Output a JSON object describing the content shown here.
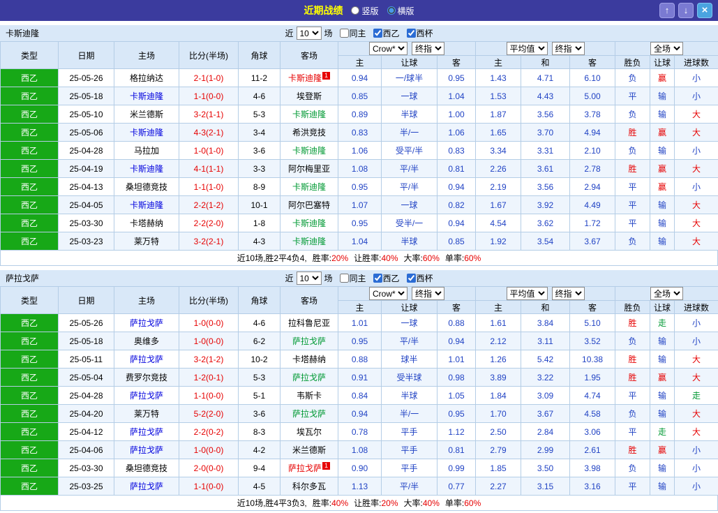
{
  "topbar": {
    "title": "近期战绩",
    "radios": [
      {
        "label": "竖版",
        "selected": false
      },
      {
        "label": "横版",
        "selected": true
      }
    ],
    "buttons": {
      "up": "↑",
      "down": "↓",
      "close": "×"
    }
  },
  "filter": {
    "near": "近",
    "count": "10",
    "games": "场",
    "options": [
      {
        "label": "同主",
        "checked": false
      },
      {
        "label": "西乙",
        "checked": true
      },
      {
        "label": "西杯",
        "checked": true
      }
    ]
  },
  "table_header": {
    "row1": [
      "类型",
      "日期",
      "主场",
      "比分(半场)",
      "角球",
      "客场"
    ],
    "dropdowns": {
      "asia": [
        "Crow*",
        "终指"
      ],
      "euro": [
        "平均值",
        "终指"
      ],
      "result": [
        "全场"
      ]
    },
    "row2": [
      "主",
      "让球",
      "客",
      "主",
      "和",
      "客",
      "胜负",
      "让球",
      "进球数"
    ]
  },
  "sections": [
    {
      "team": "卡斯迪隆",
      "rows": [
        {
          "league": "西乙",
          "date": "25-05-26",
          "home": "格拉纳达",
          "home_color": "black",
          "score": "2-1(1-0)",
          "corners": "11-2",
          "away": "卡斯迪隆",
          "away_color": "red",
          "away_badge": "1",
          "asia_home": "0.94",
          "handicap": "一/球半",
          "asia_away": "0.95",
          "euro_home": "1.43",
          "euro_draw": "4.71",
          "euro_away": "6.10",
          "result": "负",
          "handicap_result": "赢",
          "goals_result": "小"
        },
        {
          "league": "西乙",
          "date": "25-05-18",
          "home": "卡斯迪隆",
          "home_color": "blue",
          "score": "1-1(0-0)",
          "corners": "4-6",
          "away": "埃登斯",
          "away_color": "black",
          "asia_home": "0.85",
          "handicap": "一球",
          "asia_away": "1.04",
          "euro_home": "1.53",
          "euro_draw": "4.43",
          "euro_away": "5.00",
          "result": "平",
          "handicap_result": "输",
          "goals_result": "小"
        },
        {
          "league": "西乙",
          "date": "25-05-10",
          "home": "米兰德斯",
          "home_color": "black",
          "score": "3-2(1-1)",
          "corners": "5-3",
          "away": "卡斯迪隆",
          "away_color": "green",
          "asia_home": "0.89",
          "handicap": "半球",
          "asia_away": "1.00",
          "euro_home": "1.87",
          "euro_draw": "3.56",
          "euro_away": "3.78",
          "result": "负",
          "handicap_result": "输",
          "goals_result": "大"
        },
        {
          "league": "西乙",
          "date": "25-05-06",
          "home": "卡斯迪隆",
          "home_color": "blue",
          "score": "4-3(2-1)",
          "corners": "3-4",
          "away": "希洪竞技",
          "away_color": "black",
          "asia_home": "0.83",
          "handicap": "半/一",
          "asia_away": "1.06",
          "euro_home": "1.65",
          "euro_draw": "3.70",
          "euro_away": "4.94",
          "result": "胜",
          "handicap_result": "赢",
          "goals_result": "大"
        },
        {
          "league": "西乙",
          "date": "25-04-28",
          "home": "马拉加",
          "home_color": "black",
          "score": "1-0(1-0)",
          "corners": "3-6",
          "away": "卡斯迪隆",
          "away_color": "green",
          "asia_home": "1.06",
          "handicap": "受平/半",
          "asia_away": "0.83",
          "euro_home": "3.34",
          "euro_draw": "3.31",
          "euro_away": "2.10",
          "result": "负",
          "handicap_result": "输",
          "goals_result": "小"
        },
        {
          "league": "西乙",
          "date": "25-04-19",
          "home": "卡斯迪隆",
          "home_color": "blue",
          "score": "4-1(1-1)",
          "corners": "3-3",
          "away": "阿尔梅里亚",
          "away_color": "black",
          "asia_home": "1.08",
          "handicap": "平/半",
          "asia_away": "0.81",
          "euro_home": "2.26",
          "euro_draw": "3.61",
          "euro_away": "2.78",
          "result": "胜",
          "handicap_result": "赢",
          "goals_result": "大"
        },
        {
          "league": "西乙",
          "date": "25-04-13",
          "home": "桑坦德竞技",
          "home_color": "black",
          "score": "1-1(1-0)",
          "corners": "8-9",
          "away": "卡斯迪隆",
          "away_color": "green",
          "asia_home": "0.95",
          "handicap": "平/半",
          "asia_away": "0.94",
          "euro_home": "2.19",
          "euro_draw": "3.56",
          "euro_away": "2.94",
          "result": "平",
          "handicap_result": "赢",
          "goals_result": "小"
        },
        {
          "league": "西乙",
          "date": "25-04-05",
          "home": "卡斯迪隆",
          "home_color": "blue",
          "score": "2-2(1-2)",
          "corners": "10-1",
          "away": "阿尔巴塞特",
          "away_color": "black",
          "asia_home": "1.07",
          "handicap": "一球",
          "asia_away": "0.82",
          "euro_home": "1.67",
          "euro_draw": "3.92",
          "euro_away": "4.49",
          "result": "平",
          "handicap_result": "输",
          "goals_result": "大"
        },
        {
          "league": "西乙",
          "date": "25-03-30",
          "home": "卡塔赫纳",
          "home_color": "black",
          "score": "2-2(2-0)",
          "corners": "1-8",
          "away": "卡斯迪隆",
          "away_color": "green",
          "asia_home": "0.95",
          "handicap": "受半/一",
          "asia_away": "0.94",
          "euro_home": "4.54",
          "euro_draw": "3.62",
          "euro_away": "1.72",
          "result": "平",
          "handicap_result": "输",
          "goals_result": "大"
        },
        {
          "league": "西乙",
          "date": "25-03-23",
          "home": "莱万特",
          "home_color": "black",
          "score": "3-2(2-1)",
          "corners": "4-3",
          "away": "卡斯迪隆",
          "away_color": "green",
          "asia_home": "1.04",
          "handicap": "半球",
          "asia_away": "0.85",
          "euro_home": "1.92",
          "euro_draw": "3.54",
          "euro_away": "3.67",
          "result": "负",
          "handicap_result": "输",
          "goals_result": "大"
        }
      ],
      "summary": {
        "record": "近10场,胜2平4负4,",
        "stats": [
          [
            "胜率:",
            "20%"
          ],
          [
            "让胜率:",
            "40%"
          ],
          [
            "大率:",
            "60%"
          ],
          [
            "单率:",
            "60%"
          ]
        ]
      }
    },
    {
      "team": "萨拉戈萨",
      "rows": [
        {
          "league": "西乙",
          "date": "25-05-26",
          "home": "萨拉戈萨",
          "home_color": "blue",
          "score": "1-0(0-0)",
          "corners": "4-6",
          "away": "拉科鲁尼亚",
          "away_color": "black",
          "asia_home": "1.01",
          "handicap": "一球",
          "asia_away": "0.88",
          "euro_home": "1.61",
          "euro_draw": "3.84",
          "euro_away": "5.10",
          "result": "胜",
          "handicap_result": "走",
          "goals_result": "小"
        },
        {
          "league": "西乙",
          "date": "25-05-18",
          "home": "奥维多",
          "home_color": "black",
          "score": "1-0(0-0)",
          "corners": "6-2",
          "away": "萨拉戈萨",
          "away_color": "green",
          "asia_home": "0.95",
          "handicap": "平/半",
          "asia_away": "0.94",
          "euro_home": "2.12",
          "euro_draw": "3.11",
          "euro_away": "3.52",
          "result": "负",
          "handicap_result": "输",
          "goals_result": "小"
        },
        {
          "league": "西乙",
          "date": "25-05-11",
          "home": "萨拉戈萨",
          "home_color": "blue",
          "score": "3-2(1-2)",
          "corners": "10-2",
          "away": "卡塔赫纳",
          "away_color": "black",
          "asia_home": "0.88",
          "handicap": "球半",
          "asia_away": "1.01",
          "euro_home": "1.26",
          "euro_draw": "5.42",
          "euro_away": "10.38",
          "result": "胜",
          "handicap_result": "输",
          "goals_result": "大"
        },
        {
          "league": "西乙",
          "date": "25-05-04",
          "home": "费罗尔竞技",
          "home_color": "black",
          "score": "1-2(0-1)",
          "corners": "5-3",
          "away": "萨拉戈萨",
          "away_color": "green",
          "asia_home": "0.91",
          "handicap": "受半球",
          "asia_away": "0.98",
          "euro_home": "3.89",
          "euro_draw": "3.22",
          "euro_away": "1.95",
          "result": "胜",
          "handicap_result": "赢",
          "goals_result": "大"
        },
        {
          "league": "西乙",
          "date": "25-04-28",
          "home": "萨拉戈萨",
          "home_color": "blue",
          "score": "1-1(0-0)",
          "corners": "5-1",
          "away": "韦斯卡",
          "away_color": "black",
          "asia_home": "0.84",
          "handicap": "半球",
          "asia_away": "1.05",
          "euro_home": "1.84",
          "euro_draw": "3.09",
          "euro_away": "4.74",
          "result": "平",
          "handicap_result": "输",
          "goals_result": "走"
        },
        {
          "league": "西乙",
          "date": "25-04-20",
          "home": "莱万特",
          "home_color": "black",
          "score": "5-2(2-0)",
          "corners": "3-6",
          "away": "萨拉戈萨",
          "away_color": "green",
          "asia_home": "0.94",
          "handicap": "半/一",
          "asia_away": "0.95",
          "euro_home": "1.70",
          "euro_draw": "3.67",
          "euro_away": "4.58",
          "result": "负",
          "handicap_result": "输",
          "goals_result": "大"
        },
        {
          "league": "西乙",
          "date": "25-04-12",
          "home": "萨拉戈萨",
          "home_color": "blue",
          "score": "2-2(0-2)",
          "corners": "8-3",
          "away": "埃瓦尔",
          "away_color": "black",
          "asia_home": "0.78",
          "handicap": "平手",
          "asia_away": "1.12",
          "euro_home": "2.50",
          "euro_draw": "2.84",
          "euro_away": "3.06",
          "result": "平",
          "handicap_result": "走",
          "goals_result": "大"
        },
        {
          "league": "西乙",
          "date": "25-04-06",
          "home": "萨拉戈萨",
          "home_color": "blue",
          "score": "1-0(0-0)",
          "corners": "4-2",
          "away": "米兰德斯",
          "away_color": "black",
          "asia_home": "1.08",
          "handicap": "平手",
          "asia_away": "0.81",
          "euro_home": "2.79",
          "euro_draw": "2.99",
          "euro_away": "2.61",
          "result": "胜",
          "handicap_result": "赢",
          "goals_result": "小"
        },
        {
          "league": "西乙",
          "date": "25-03-30",
          "home": "桑坦德竞技",
          "home_color": "black",
          "score": "2-0(0-0)",
          "corners": "9-4",
          "away": "萨拉戈萨",
          "away_color": "red",
          "away_badge": "1",
          "asia_home": "0.90",
          "handicap": "平手",
          "asia_away": "0.99",
          "euro_home": "1.85",
          "euro_draw": "3.50",
          "euro_away": "3.98",
          "result": "负",
          "handicap_result": "输",
          "goals_result": "小"
        },
        {
          "league": "西乙",
          "date": "25-03-25",
          "home": "萨拉戈萨",
          "home_color": "blue",
          "score": "1-1(0-0)",
          "corners": "4-5",
          "away": "科尔多瓦",
          "away_color": "black",
          "asia_home": "1.13",
          "handicap": "平/半",
          "asia_away": "0.77",
          "euro_home": "2.27",
          "euro_draw": "3.15",
          "euro_away": "3.16",
          "result": "平",
          "handicap_result": "输",
          "goals_result": "小"
        }
      ],
      "summary": {
        "record": "近10场,胜4平3负3,",
        "stats": [
          [
            "胜率:",
            "40%"
          ],
          [
            "让胜率:",
            "20%"
          ],
          [
            "大率:",
            "40%"
          ],
          [
            "单率:",
            "60%"
          ]
        ]
      }
    }
  ]
}
